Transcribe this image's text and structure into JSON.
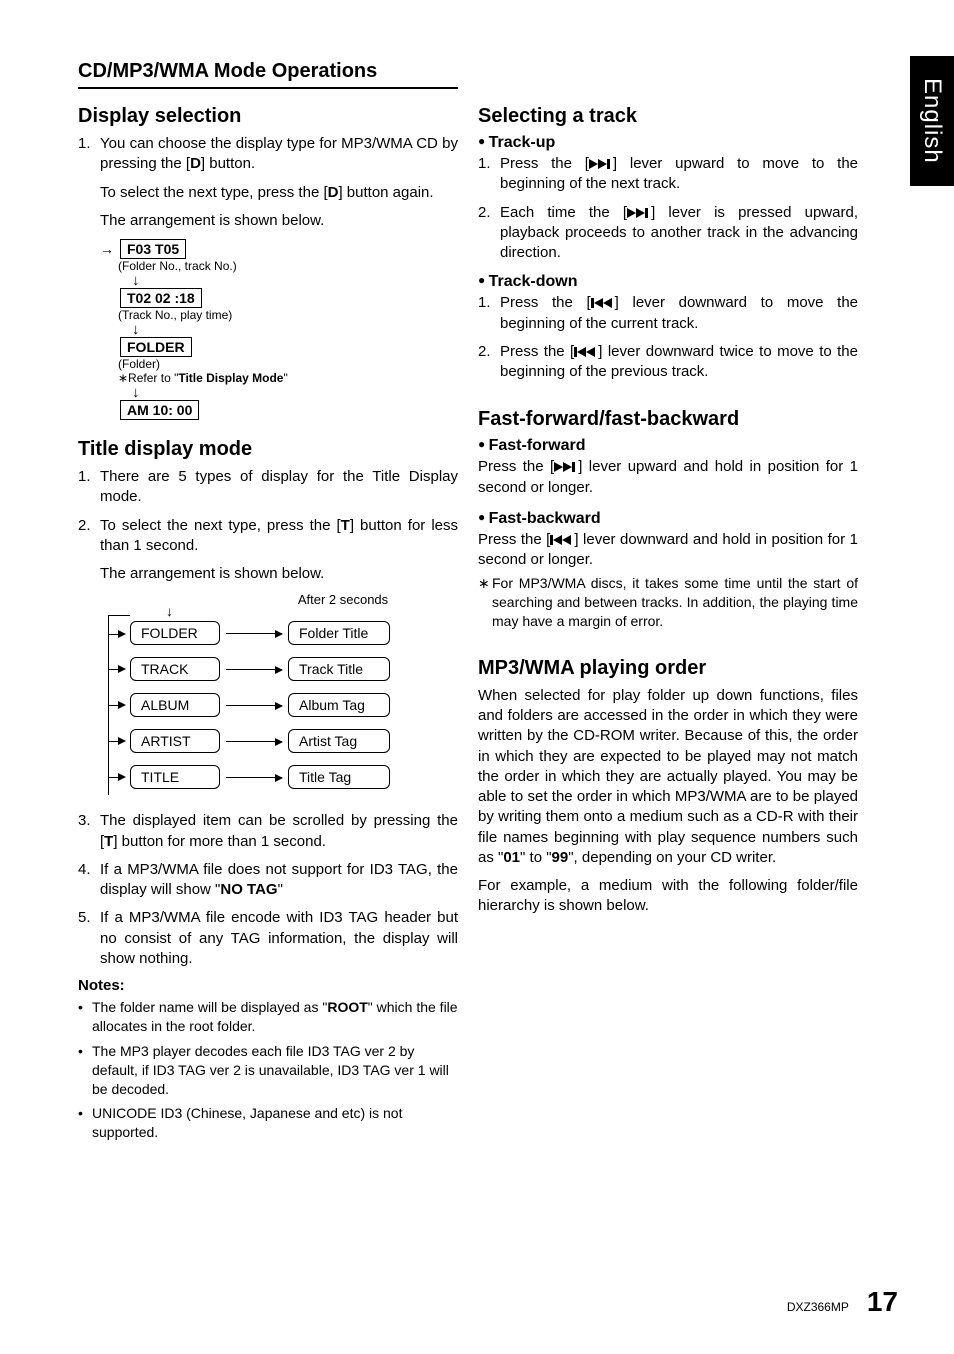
{
  "sideTab": "English",
  "sectionHeader": "CD/MP3/WMA Mode Operations",
  "left": {
    "displaySelection": {
      "title": "Display selection",
      "item1_num": "1.",
      "item1_text_a": "You can choose the display type for MP3/WMA CD by pressing the [",
      "item1_bold": "D",
      "item1_text_b": "] button.",
      "para2_a": "To select the next type, press the [",
      "para2_bold": "D",
      "para2_b": "] button again.",
      "para3": "The arrangement is shown below.",
      "diagram": {
        "box1": "F03 T05",
        "cap1": "(Folder No., track No.)",
        "box2": "T02 02 :18",
        "cap2": "(Track No., play time)",
        "box3": "FOLDER",
        "cap3a": "(Folder)",
        "cap3b_a": "∗Refer to \"",
        "cap3b_bold": "Title Display Mode",
        "cap3b_b": "\"",
        "box4": "AM 10: 00"
      }
    },
    "titleDisplayMode": {
      "title": "Title display mode",
      "item1_num": "1.",
      "item1": "There are 5 types of display for the Title Display mode.",
      "item2_num": "2.",
      "item2_a": "To select the next type, press the [",
      "item2_bold": "T",
      "item2_b": "] button for less than 1 second.",
      "para": "The arrangement is shown below.",
      "after2s": "After 2 seconds",
      "rows": [
        {
          "left": "FOLDER",
          "right": "Folder Title"
        },
        {
          "left": "TRACK",
          "right": "Track Title"
        },
        {
          "left": "ALBUM",
          "right": "Album Tag"
        },
        {
          "left": "ARTIST",
          "right": "Artist Tag"
        },
        {
          "left": "TITLE",
          "right": "Title Tag"
        }
      ],
      "item3_num": "3.",
      "item3_a": "The displayed item can be scrolled by pressing the [",
      "item3_bold": "T",
      "item3_b": "] button for more than 1 second.",
      "item4_num": "4.",
      "item4_a": "If a MP3/WMA file does not support for ID3 TAG, the display will show \"",
      "item4_bold": "NO TAG",
      "item4_b": "\"",
      "item5_num": "5.",
      "item5": "If a MP3/WMA file encode with ID3 TAG header but no consist of any TAG information, the display will show nothing.",
      "notesHead": "Notes:",
      "note1_a": "The folder name will be displayed as \"",
      "note1_bold": "ROOT",
      "note1_b": "\" which the file allocates in the root folder.",
      "note2": "The MP3 player decodes each file ID3 TAG ver 2 by default, if ID3 TAG ver 2 is unavailable, ID3 TAG ver 1 will be decoded.",
      "note3": "UNICODE ID3 (Chinese, Japanese and etc) is not supported."
    }
  },
  "right": {
    "selectingTrack": {
      "title": "Selecting a track",
      "trackUpHead": "Track-up",
      "tu1_num": "1.",
      "tu1_a": "Press the [",
      "tu1_b": "] lever upward to move to the beginning of the next track.",
      "tu2_num": "2.",
      "tu2_a": "Each time the [",
      "tu2_b": "] lever is pressed upward, playback proceeds to another track in the advancing direction.",
      "trackDownHead": "Track-down",
      "td1_num": "1.",
      "td1_a": "Press the [",
      "td1_b": "] lever downward to move the beginning of the current track.",
      "td2_num": "2.",
      "td2_a": "Press the [",
      "td2_b": "] lever downward twice to move to the beginning of the previous track."
    },
    "fastFwd": {
      "title": "Fast-forward/fast-backward",
      "ffHead": "Fast-forward",
      "ff_a": "Press the [",
      "ff_b": "] lever upward and hold in position for 1 second or longer.",
      "fbHead": "Fast-backward",
      "fb_a": "Press the [",
      "fb_b": "] lever downward and hold in position for 1 second or longer.",
      "ast": "∗",
      "astNote": "For MP3/WMA discs, it takes some time until the start of searching and between tracks. In addition, the playing time may have a margin of error."
    },
    "playOrder": {
      "title": "MP3/WMA playing order",
      "para1_a": "When selected for play folder up down functions, files and folders are accessed in the order in which they were written by the CD-ROM writer. Because of this, the order in which they are expected to be played may not match the order in which they are actually played. You may be able to set the order in which MP3/WMA are to be played by writing them onto a medium such as a CD-R with their file names beginning with play sequence numbers such as \"",
      "para1_b1": "01",
      "para1_mid": "\" to \"",
      "para1_b2": "99",
      "para1_c": "\", depending on your CD writer.",
      "para2": "For example, a medium with the following folder/file hierarchy is shown below."
    }
  },
  "footer": {
    "model": "DXZ366MP",
    "page": "17"
  }
}
